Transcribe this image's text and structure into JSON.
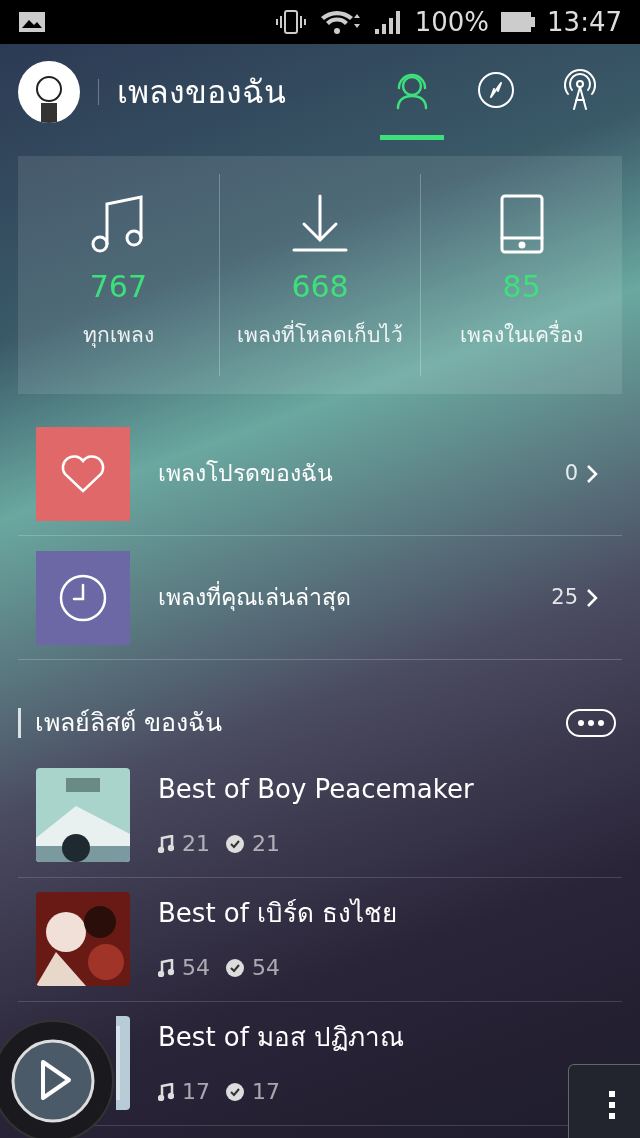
{
  "status_bar": {
    "battery": "100%",
    "time": "13:47"
  },
  "header": {
    "title": "เพลงของฉัน",
    "tabs": [
      {
        "kind": "headphones",
        "selected": true
      },
      {
        "kind": "compass",
        "selected": false
      },
      {
        "kind": "tower",
        "selected": false
      }
    ]
  },
  "stats": [
    {
      "kind": "music",
      "count": "767",
      "label": "ทุกเพลง"
    },
    {
      "kind": "download",
      "count": "668",
      "label": "เพลงที่โหลดเก็บไว้"
    },
    {
      "kind": "phone",
      "count": "85",
      "label": "เพลงในเครื่อง"
    }
  ],
  "shortcuts": [
    {
      "kind": "heart",
      "color": "#e06868",
      "label": "เพลงโปรดของฉัน",
      "count": "0"
    },
    {
      "kind": "clock",
      "color": "#6c68a6",
      "label": "เพลงที่คุณเล่นล่าสุด",
      "count": "25"
    }
  ],
  "playlists": {
    "title": "เพลย์ลิสต์ ของฉัน",
    "items": [
      {
        "title": "Best of Boy Peacemaker",
        "songs": "21",
        "downloaded": "21"
      },
      {
        "title": "Best of เบิร์ด ธงไชย",
        "songs": "54",
        "downloaded": "54"
      },
      {
        "title": "Best of มอส ปฏิภาณ",
        "songs": "17",
        "downloaded": "17"
      }
    ]
  }
}
